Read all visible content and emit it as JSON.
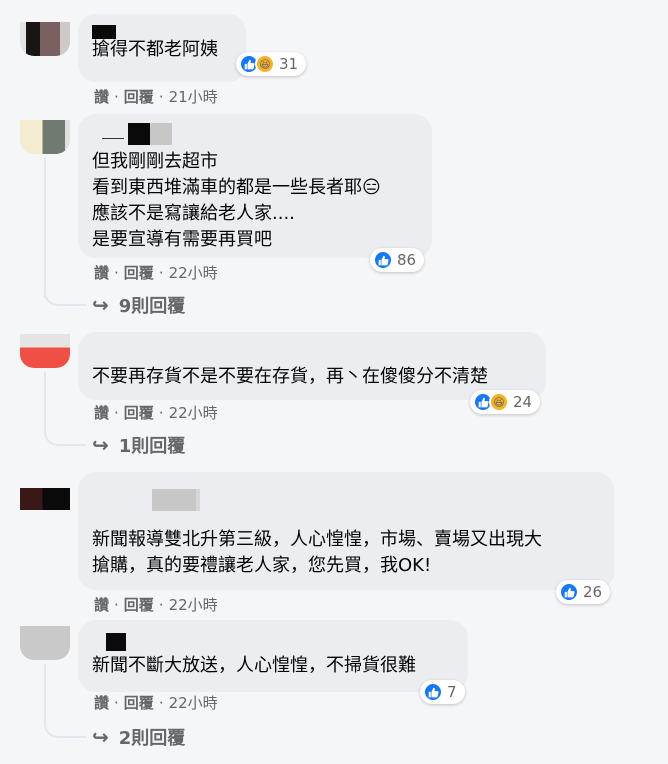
{
  "comments": [
    {
      "text": "搶得不都老阿姨",
      "reactions": {
        "types": [
          "like",
          "haha"
        ],
        "count": "31"
      },
      "actions": {
        "read": "讚",
        "reply": "回覆",
        "time": "21小時"
      }
    },
    {
      "text": "但我剛剛去超市\n看到東西堆滿車的都是一些長者耶😑\n應該不是寫讓給老人家....\n是要宣導有需要再買吧",
      "reactions": {
        "types": [
          "like"
        ],
        "count": "86"
      },
      "actions": {
        "read": "讚",
        "reply": "回覆",
        "time": "22小時"
      },
      "replies": "9則回覆"
    },
    {
      "text": "不要再存貨不是不要在存貨，再丶在傻傻分不清楚",
      "reactions": {
        "types": [
          "like",
          "haha"
        ],
        "count": "24"
      },
      "actions": {
        "read": "讚",
        "reply": "回覆",
        "time": "22小時"
      },
      "replies": "1則回覆"
    },
    {
      "text": "新聞報導雙北升第三級，人心惶惶，市場、賣場又出現大\n搶購，真的要禮讓老人家，您先買，我OK!",
      "reactions": {
        "types": [
          "like"
        ],
        "count": "26"
      },
      "actions": {
        "read": "讚",
        "reply": "回覆",
        "time": "22小時"
      }
    },
    {
      "text": "新聞不斷大放送，人心惶惶，不掃貨很難",
      "reactions": {
        "types": [
          "like"
        ],
        "count": "7"
      },
      "actions": {
        "read": "讚",
        "reply": "回覆",
        "time": "22小時"
      },
      "replies": "2則回覆"
    }
  ],
  "colors": {
    "like": "#1877f2",
    "haha": "#f7b125",
    "bubble": "#ebedf0",
    "meta": "#65676b"
  }
}
